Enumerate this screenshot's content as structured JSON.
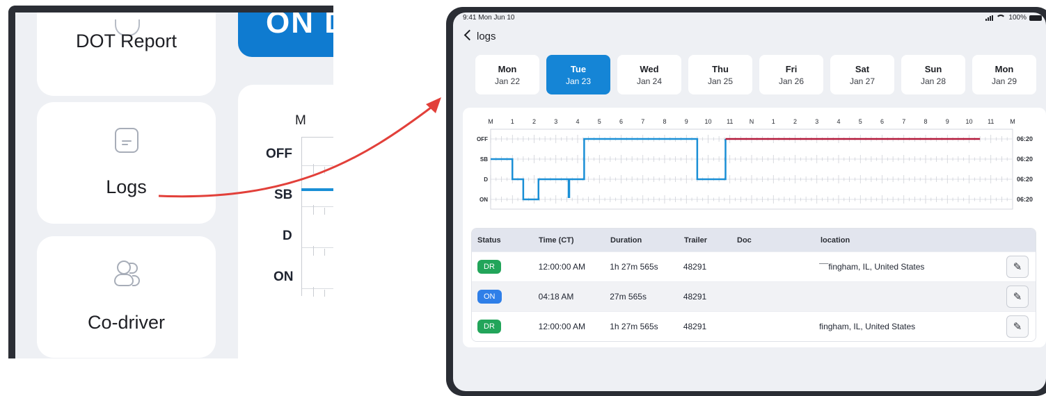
{
  "inset": {
    "items": [
      {
        "label": "DOT Report",
        "icon": "shield-icon"
      },
      {
        "label": "Logs",
        "icon": "document-icon"
      },
      {
        "label": "Co-driver",
        "icon": "users-icon"
      }
    ],
    "duty_button_text": "ON D",
    "chart": {
      "top_label": "M",
      "rows": [
        "OFF",
        "SB",
        "D",
        "ON"
      ]
    }
  },
  "arrow_color": "#e2403a",
  "status_bar": {
    "time": "9:41  Mon Jun 10",
    "battery": "100%"
  },
  "nav": {
    "back_label": "logs"
  },
  "days": [
    {
      "day": "Mon",
      "date": "Jan 22",
      "selected": false
    },
    {
      "day": "Tue",
      "date": "Jan 23",
      "selected": true
    },
    {
      "day": "Wed",
      "date": "Jan 24",
      "selected": false
    },
    {
      "day": "Thu",
      "date": "Jan 25",
      "selected": false
    },
    {
      "day": "Fri",
      "date": "Jan 26",
      "selected": false
    },
    {
      "day": "Sat",
      "date": "Jan 27",
      "selected": false
    },
    {
      "day": "Sun",
      "date": "Jan 28",
      "selected": false
    },
    {
      "day": "Mon",
      "date": "Jan 29",
      "selected": false
    }
  ],
  "accent_color": "#1585d6",
  "chart_data": {
    "type": "line",
    "x_ticks": [
      "M",
      "1",
      "2",
      "3",
      "4",
      "5",
      "6",
      "7",
      "8",
      "9",
      "10",
      "11",
      "N",
      "1",
      "2",
      "3",
      "4",
      "5",
      "6",
      "7",
      "8",
      "9",
      "10",
      "11",
      "M"
    ],
    "rows": [
      "OFF",
      "SB",
      "D",
      "ON"
    ],
    "row_totals": [
      "06:20",
      "06:20",
      "06:20",
      "06:20"
    ],
    "series": [
      {
        "color": "#1a8fd6",
        "steps": [
          {
            "x": 0,
            "status": "SB"
          },
          {
            "x": 1,
            "status": "SB"
          },
          {
            "x": 1,
            "status": "D"
          },
          {
            "x": 1.5,
            "status": "D"
          },
          {
            "x": 1.5,
            "status": "ON"
          },
          {
            "x": 2.2,
            "status": "ON"
          },
          {
            "x": 2.2,
            "status": "D"
          },
          {
            "x": 4.3,
            "status": "D"
          },
          {
            "x": 4.3,
            "status": "OFF"
          },
          {
            "x": 9.5,
            "status": "OFF"
          },
          {
            "x": 9.5,
            "status": "D"
          },
          {
            "x": 10.8,
            "status": "D"
          },
          {
            "x": 10.8,
            "status": "OFF"
          }
        ],
        "spike": {
          "x": 3.6,
          "from": "D",
          "to": "ON"
        }
      },
      {
        "color": "#b3193a",
        "steps": [
          {
            "x": 10.8,
            "status": "OFF"
          },
          {
            "x": 22.5,
            "status": "OFF"
          }
        ]
      }
    ]
  },
  "table": {
    "headers": {
      "status": "Status",
      "time": "Time (CT)",
      "duration": "Duration",
      "trailer": "Trailer",
      "doc": "Doc",
      "location": "location"
    },
    "rows": [
      {
        "status": "DR",
        "type": "dr",
        "time": "12:00:00 AM",
        "duration": "1h 27m 565s",
        "trailer": "48291",
        "doc": "",
        "location": "¯¯fingham, IL, United States"
      },
      {
        "status": "ON",
        "type": "on",
        "time": "04:18 AM",
        "duration": "27m 565s",
        "trailer": "48291",
        "doc": "",
        "location": ""
      },
      {
        "status": "DR",
        "type": "dr",
        "time": "12:00:00 AM",
        "duration": "1h 27m 565s",
        "trailer": "48291",
        "doc": "",
        "location": "fingham, IL, United States"
      }
    ]
  }
}
